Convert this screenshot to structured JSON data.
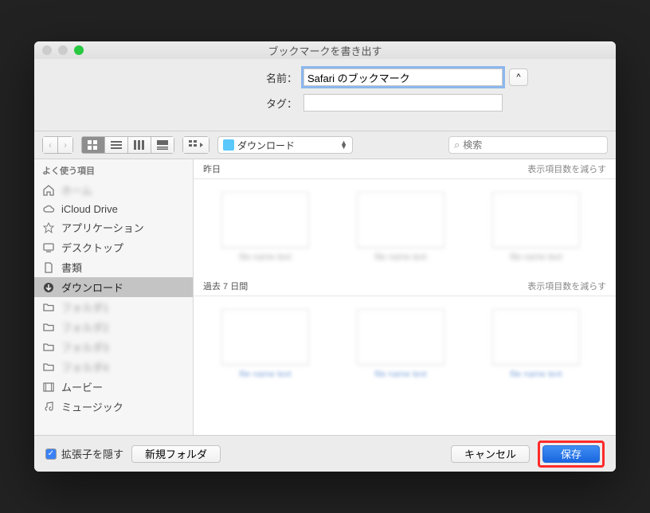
{
  "window": {
    "title": "ブックマークを書き出す"
  },
  "header": {
    "name_label": "名前：",
    "name_value": "Safari のブックマーク",
    "tag_label": "タグ：",
    "tag_value": "",
    "expand_label": "^"
  },
  "toolbar": {
    "nav_back": "‹",
    "nav_fwd": "›",
    "location_label": "ダウンロード",
    "search_placeholder": "検索"
  },
  "sidebar": {
    "header": "よく使う項目",
    "items": [
      {
        "icon": "home",
        "label": "ホーム"
      },
      {
        "icon": "cloud",
        "label": "iCloud Drive"
      },
      {
        "icon": "app",
        "label": "アプリケーション"
      },
      {
        "icon": "desktop",
        "label": "デスクトップ"
      },
      {
        "icon": "doc",
        "label": "書類"
      },
      {
        "icon": "download",
        "label": "ダウンロード"
      },
      {
        "icon": "folder",
        "label": "フォルダ1"
      },
      {
        "icon": "folder",
        "label": "フォルダ2"
      },
      {
        "icon": "folder",
        "label": "フォルダ3"
      },
      {
        "icon": "folder",
        "label": "フォルダ4"
      },
      {
        "icon": "movie",
        "label": "ムービー"
      },
      {
        "icon": "music",
        "label": "ミュージック"
      }
    ],
    "selected_index": 5,
    "blurred_indices": [
      0,
      6,
      7,
      8,
      9
    ]
  },
  "content": {
    "groups": [
      {
        "title": "昨日",
        "less": "表示項目数を減らす",
        "count": 3
      },
      {
        "title": "過去 7 日間",
        "less": "表示項目数を減らす",
        "count": 3
      }
    ]
  },
  "footer": {
    "hide_ext_label": "拡張子を隠す",
    "hide_ext_checked": true,
    "new_folder": "新規フォルダ",
    "cancel": "キャンセル",
    "save": "保存"
  }
}
